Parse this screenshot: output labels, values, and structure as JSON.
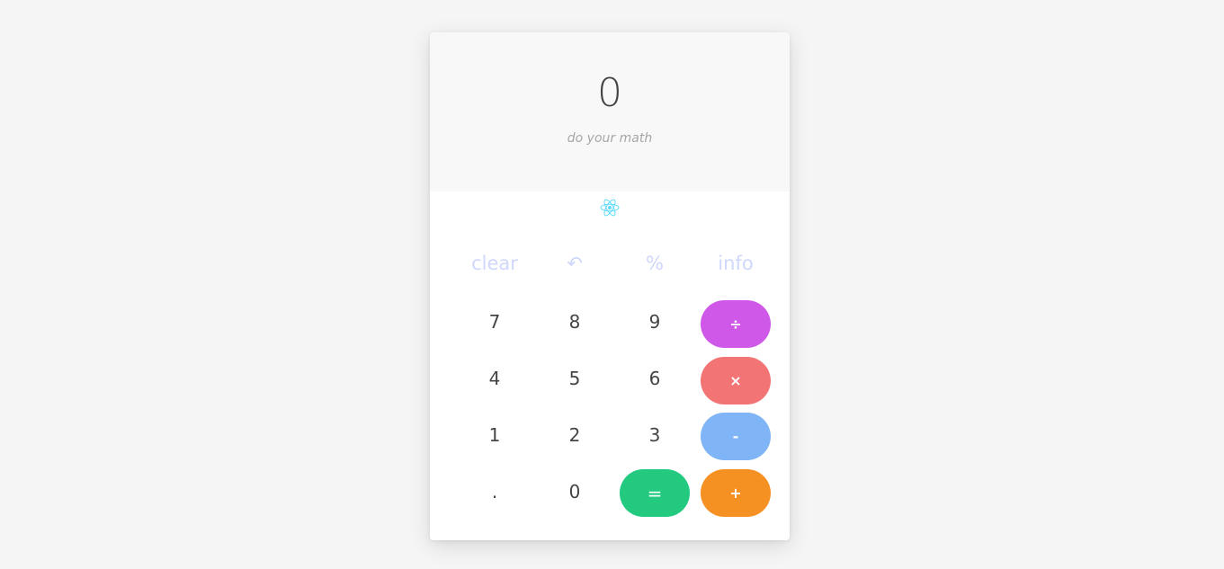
{
  "display": {
    "value": "0",
    "hint": "do your math"
  },
  "logo_icon": "react-atom-icon",
  "function_keys": {
    "clear": "clear",
    "undo": "↶",
    "percent": "%",
    "info": "info"
  },
  "digit_keys": {
    "seven": "7",
    "eight": "8",
    "nine": "9",
    "four": "4",
    "five": "5",
    "six": "6",
    "one": "1",
    "two": "2",
    "three": "3",
    "dot": ".",
    "zero": "0"
  },
  "operator_keys": {
    "divide": "÷",
    "multiply": "×",
    "subtract": "-",
    "equals": "=",
    "add": "+"
  },
  "colors": {
    "page_background": "#f5f5f5",
    "display_background": "#f8f8f8",
    "function_text": "#cfd7fb",
    "logo": "#61dafb",
    "divide": "#cf58e8",
    "multiply": "#f37474",
    "subtract": "#7fb4f6",
    "equals": "#22c97f",
    "add": "#f59023"
  }
}
